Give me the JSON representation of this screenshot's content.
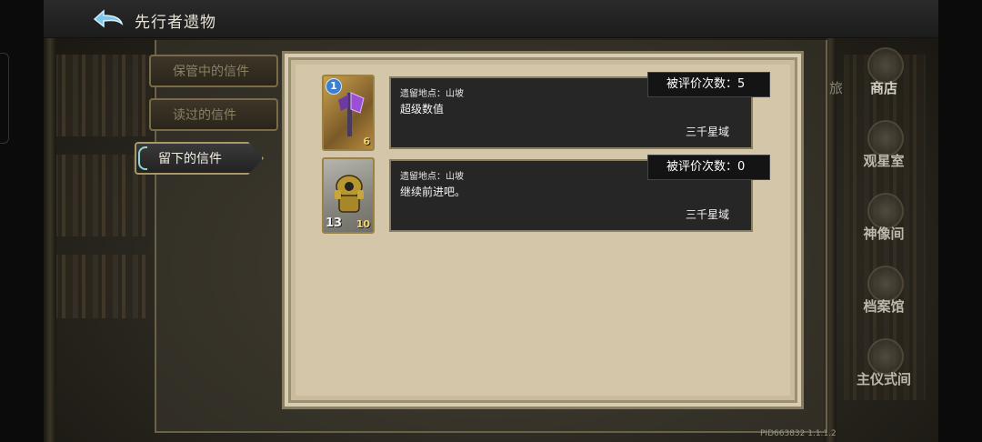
{
  "header": {
    "title": "先行者遗物"
  },
  "tabs": [
    {
      "label": "保管中的信件",
      "active": false
    },
    {
      "label": "读过的信件",
      "active": false
    },
    {
      "label": "留下的信件",
      "active": true
    }
  ],
  "letters": [
    {
      "location": "遗留地点：山坡",
      "message": "超级数值",
      "server": "三千星域",
      "rating": "被评价次数：5",
      "card": {
        "cost": "1",
        "left_stat": "",
        "right_stat": "6",
        "style": "gold"
      }
    },
    {
      "location": "遗留地点：山坡",
      "message": "继续前进吧。",
      "server": "三千星域",
      "rating": "被评价次数：0",
      "card": {
        "cost": "",
        "left_stat": "13",
        "right_stat": "10",
        "style": "grey"
      }
    }
  ],
  "right_nav": {
    "partial_label": "旅",
    "items": [
      {
        "label": "商店",
        "icon": "shop-icon"
      },
      {
        "label": "观星室",
        "icon": "observatory-icon"
      },
      {
        "label": "神像间",
        "icon": "statue-icon"
      },
      {
        "label": "档案馆",
        "icon": "archive-icon"
      },
      {
        "label": "主仪式间",
        "icon": "ritual-icon"
      }
    ]
  },
  "footer": {
    "pid": "PID663832  1.1.1.2"
  }
}
